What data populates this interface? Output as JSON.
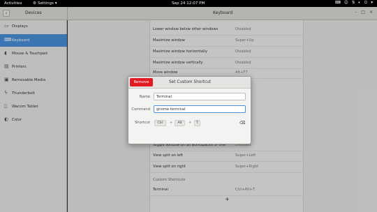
{
  "topbar": {
    "activities": "Activities",
    "app_menu": "Settings ▾",
    "clock": "Sep 24  12:07 PM"
  },
  "header": {
    "sidebar_title": "Devices",
    "main_title": "Keyboard"
  },
  "sidebar": {
    "items": [
      {
        "label": "Displays",
        "icon": "display-icon"
      },
      {
        "label": "Keyboard",
        "icon": "keyboard-icon",
        "active": true
      },
      {
        "label": "Mouse & Touchpad",
        "icon": "mouse-icon"
      },
      {
        "label": "Printers",
        "icon": "printer-icon"
      },
      {
        "label": "Removable Media",
        "icon": "media-icon"
      },
      {
        "label": "Thunderbolt",
        "icon": "thunderbolt-icon"
      },
      {
        "label": "Wacom Tablet",
        "icon": "tablet-icon"
      },
      {
        "label": "Color",
        "icon": "color-icon"
      }
    ]
  },
  "shortcuts": {
    "rows": [
      {
        "name": "Lower window below other windows",
        "accel": "Disabled"
      },
      {
        "name": "Maximize window",
        "accel": "Super+Up"
      },
      {
        "name": "Maximize window horizontally",
        "accel": "Disabled"
      },
      {
        "name": "Maximize window vertically",
        "accel": "Disabled"
      },
      {
        "name": "Move window",
        "accel": "Alt+F7"
      },
      {
        "name": "Toggle window on all workspaces or one",
        "accel": "Disabled"
      },
      {
        "name": "View split on left",
        "accel": "Super+Left"
      },
      {
        "name": "View split on right",
        "accel": "Super+Right"
      }
    ],
    "custom_section": "Custom Shortcuts",
    "custom_rows": [
      {
        "name": "Terminal",
        "accel": "Ctrl+Alt+T"
      }
    ],
    "add_label": "+"
  },
  "dialog": {
    "title": "Set Custom Shortcut",
    "remove_label": "Remove",
    "name_label": "Name",
    "name_value": "Terminal",
    "command_label": "Command",
    "command_value": "gnome-terminal",
    "shortcut_label": "Shortcut",
    "keys": [
      "Ctrl",
      "Alt",
      "T"
    ],
    "plus": "+"
  }
}
